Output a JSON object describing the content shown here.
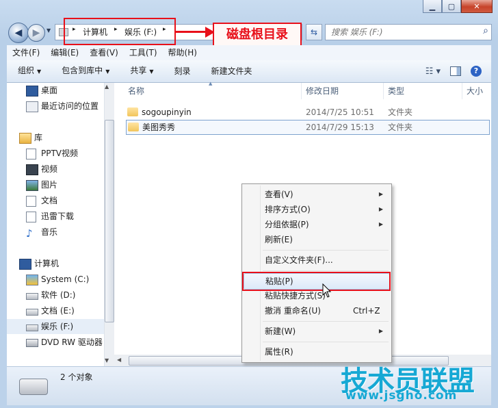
{
  "window": {
    "controls": {
      "minimize": "▁",
      "maximize": "▢",
      "close": "✕"
    }
  },
  "address": {
    "segments": [
      "计算机",
      "娱乐 (F:)"
    ],
    "sep": "▸"
  },
  "annotation": {
    "label": "磁盘根目录",
    "color": "#e8101a"
  },
  "search": {
    "placeholder": "搜索 娱乐 (F:)"
  },
  "menubar": [
    "文件(F)",
    "编辑(E)",
    "查看(V)",
    "工具(T)",
    "帮助(H)"
  ],
  "toolbar": {
    "organize": "组织",
    "include": "包含到库中",
    "share": "共享",
    "burn": "刻录",
    "new_folder": "新建文件夹"
  },
  "nav": {
    "desktop": "桌面",
    "recent": "最近访问的位置",
    "library": "库",
    "pptv": "PPTV视频",
    "videos": "视频",
    "pictures": "图片",
    "docs": "文档",
    "xunlei": "迅雷下载",
    "music": "音乐",
    "computer": "计算机",
    "c": "System (C:)",
    "d": "软件 (D:)",
    "e": "文档 (E:)",
    "f": "娱乐 (F:)",
    "dvd": "DVD RW 驱动器"
  },
  "columns": {
    "name": "名称",
    "date": "修改日期",
    "type": "类型",
    "size": "大小"
  },
  "files": [
    {
      "name": "sogoupinyin",
      "date": "2014/7/25 10:51",
      "type": "文件夹"
    },
    {
      "name": "美图秀秀",
      "date": "2014/7/29 15:13",
      "type": "文件夹"
    }
  ],
  "status": {
    "count": "2 个对象"
  },
  "context_menu": {
    "view": "查看(V)",
    "sort": "排序方式(O)",
    "group": "分组依据(P)",
    "refresh": "刷新(E)",
    "customize": "自定义文件夹(F)...",
    "paste": "粘贴(P)",
    "paste_shortcut": "粘贴快捷方式(S)",
    "undo": "撤消 重命名(U)",
    "undo_key": "Ctrl+Z",
    "new": "新建(W)",
    "properties": "属性(R)"
  },
  "watermark": {
    "title": "技术员联盟",
    "url": "www.jsgho.com"
  }
}
